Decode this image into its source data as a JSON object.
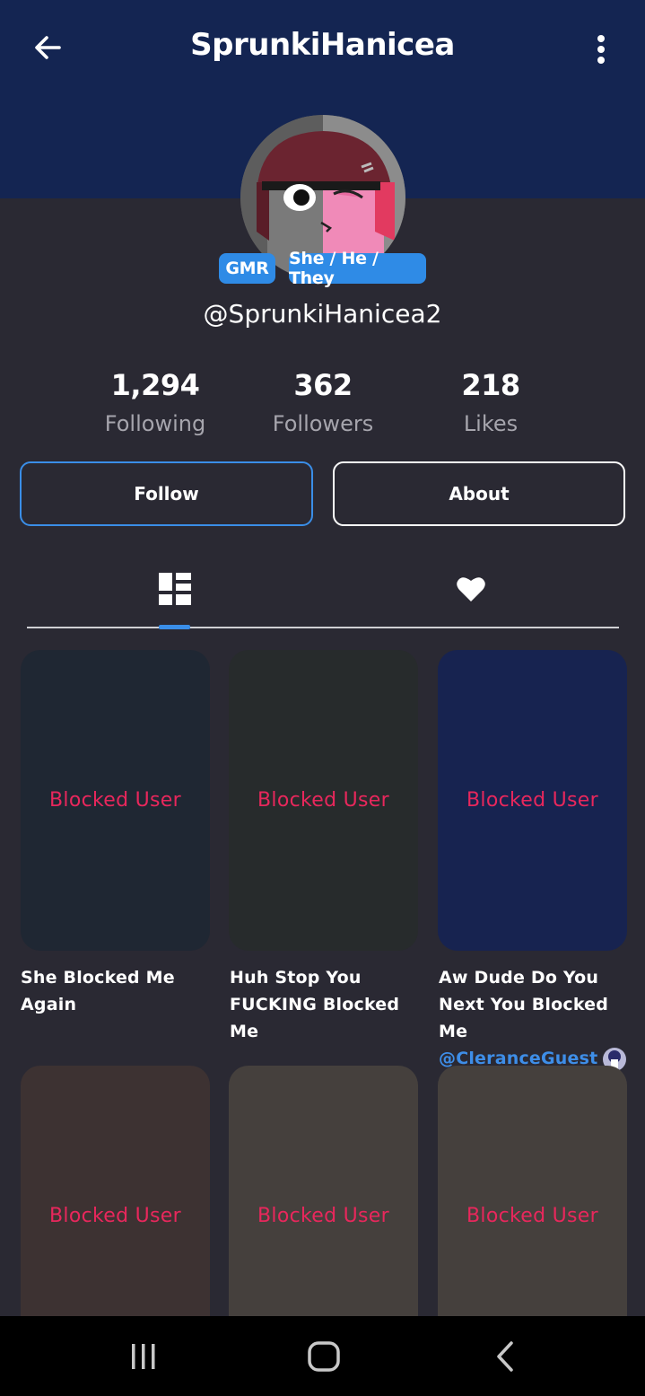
{
  "header": {
    "title": "SprunkiHanicea",
    "background": "#142552",
    "back_icon": "arrow-left-icon",
    "menu_icon": "more-vertical-icon"
  },
  "profile": {
    "badges": [
      "GMR",
      "She / He / They"
    ],
    "handle": "@SprunkiHanicea2",
    "stats": [
      {
        "value": "1,294",
        "label": "Following"
      },
      {
        "value": "362",
        "label": "Followers"
      },
      {
        "value": "218",
        "label": "Likes"
      }
    ]
  },
  "actions": {
    "follow_label": "Follow",
    "about_label": "About",
    "accent": "#3a8ee8"
  },
  "tabs": [
    {
      "icon": "grid-icon",
      "active": true
    },
    {
      "icon": "heart-icon",
      "active": false
    }
  ],
  "posts": [
    {
      "overlay": "Blocked User",
      "caption": "She Blocked Me Again",
      "mention": "",
      "bg": "#1f2733"
    },
    {
      "overlay": "Blocked User",
      "caption": "Huh Stop You FUCKING Blocked Me",
      "mention": "",
      "bg": "#272b2c"
    },
    {
      "overlay": "Blocked User",
      "caption": "Aw Dude Do You Next You Blocked Me",
      "mention": "@CleranceGuest",
      "bg": "#172350"
    },
    {
      "overlay": "Blocked User",
      "caption": "",
      "mention": "",
      "bg": "#3d3232"
    },
    {
      "overlay": "Blocked User",
      "caption": "",
      "mention": "",
      "bg": "#45403d"
    },
    {
      "overlay": "Blocked User",
      "caption": "",
      "mention": "",
      "bg": "#45403d"
    }
  ],
  "blocked_color": "#e8275c",
  "system_nav": [
    "recents-icon",
    "home-icon",
    "back-icon"
  ]
}
